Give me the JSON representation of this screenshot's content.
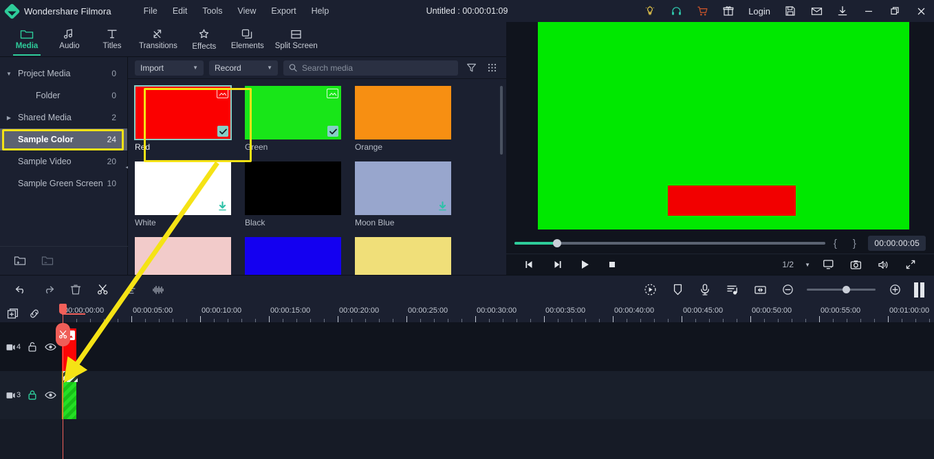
{
  "app": {
    "name": "Wondershare Filmora",
    "project_title": "Untitled : 00:00:01:09"
  },
  "menubar": [
    {
      "label": "File"
    },
    {
      "label": "Edit"
    },
    {
      "label": "Tools"
    },
    {
      "label": "View"
    },
    {
      "label": "Export"
    },
    {
      "label": "Help"
    }
  ],
  "titlebar_icons": [
    {
      "name": "lightbulb-icon",
      "color": "#e8c84a"
    },
    {
      "name": "headset-icon",
      "color": "#2ec2a8"
    },
    {
      "name": "cart-icon",
      "color": "#c4522a"
    },
    {
      "name": "gift-icon",
      "color": "#e3e6eb"
    },
    {
      "name": "save-icon",
      "color": "#e3e6eb"
    },
    {
      "name": "mail-icon",
      "color": "#e3e6eb"
    },
    {
      "name": "download-icon",
      "color": "#e3e6eb"
    }
  ],
  "login_label": "Login",
  "tooltabs": [
    {
      "label": "Media",
      "icon": "folder-icon",
      "active": true
    },
    {
      "label": "Audio",
      "icon": "music-note-icon",
      "active": false
    },
    {
      "label": "Titles",
      "icon": "text-t-icon",
      "active": false
    },
    {
      "label": "Transitions",
      "icon": "transition-arrows-icon",
      "active": false
    },
    {
      "label": "Effects",
      "icon": "sparkle-icon",
      "active": false
    },
    {
      "label": "Elements",
      "icon": "layers-icon",
      "active": false
    },
    {
      "label": "Split Screen",
      "icon": "split-screen-icon",
      "active": false
    }
  ],
  "export_label": "EXPORT",
  "sidebar": {
    "items": [
      {
        "label": "Project Media",
        "count": "0",
        "caret": "down",
        "indent": false,
        "selected": false
      },
      {
        "label": "Folder",
        "count": "0",
        "caret": "none",
        "indent": true,
        "selected": false
      },
      {
        "label": "Shared Media",
        "count": "2",
        "caret": "right",
        "indent": false,
        "selected": false
      },
      {
        "label": "Sample Color",
        "count": "24",
        "caret": "none",
        "indent": false,
        "selected": true
      },
      {
        "label": "Sample Video",
        "count": "20",
        "caret": "none",
        "indent": false,
        "selected": false
      },
      {
        "label": "Sample Green Screen",
        "count": "10",
        "caret": "none",
        "indent": false,
        "selected": false
      }
    ],
    "footer_icons": [
      {
        "name": "new-folder-icon"
      },
      {
        "name": "remove-folder-icon"
      }
    ]
  },
  "media_toolbar": {
    "import": {
      "label": "Import"
    },
    "record": {
      "label": "Record"
    },
    "search": {
      "placeholder": "Search media",
      "value": ""
    },
    "filter_icon": "filter-icon",
    "grid_icon": "grid-view-icon"
  },
  "media_items": [
    {
      "label": "Red",
      "color": "#fb0000",
      "selected": true,
      "badge_img": true,
      "badge_check": true,
      "badge_dl": false
    },
    {
      "label": "Green",
      "color": "#18e618",
      "selected": false,
      "badge_img": true,
      "badge_check": true,
      "badge_dl": false
    },
    {
      "label": "Orange",
      "color": "#f78f12",
      "selected": false,
      "badge_img": false,
      "badge_check": false,
      "badge_dl": false
    },
    {
      "label": "White",
      "color": "#ffffff",
      "selected": false,
      "badge_img": false,
      "badge_check": false,
      "badge_dl": true
    },
    {
      "label": "Black",
      "color": "#000000",
      "selected": false,
      "badge_img": false,
      "badge_check": false,
      "badge_dl": false
    },
    {
      "label": "Moon Blue",
      "color": "#98a6cd",
      "selected": false,
      "badge_img": false,
      "badge_check": false,
      "badge_dl": true
    },
    {
      "label": "",
      "color": "#f2cbca",
      "selected": false,
      "badge_img": false,
      "badge_check": false,
      "badge_dl": false
    },
    {
      "label": "",
      "color": "#1400f0",
      "selected": false,
      "badge_img": false,
      "badge_check": false,
      "badge_dl": false
    },
    {
      "label": "",
      "color": "#f0df79",
      "selected": false,
      "badge_img": false,
      "badge_check": false,
      "badge_dl": false
    }
  ],
  "preview": {
    "background_color": "#00e800",
    "rect_color": "#f20000",
    "timecode": "00:00:00:05",
    "mark_in": "{",
    "mark_out": "}",
    "ratio": "1/2",
    "transport": [
      {
        "name": "prev-frame-button"
      },
      {
        "name": "next-frame-button"
      },
      {
        "name": "play-button"
      },
      {
        "name": "stop-button"
      }
    ],
    "right_icons": [
      {
        "name": "display-settings-icon"
      },
      {
        "name": "snapshot-camera-icon"
      },
      {
        "name": "volume-icon"
      },
      {
        "name": "fullscreen-icon"
      }
    ]
  },
  "timeline_toolbar": {
    "left_icons": [
      {
        "name": "undo-icon"
      },
      {
        "name": "redo-icon"
      },
      {
        "name": "delete-icon"
      },
      {
        "name": "split-scissors-icon"
      },
      {
        "name": "crop-icon"
      },
      {
        "name": "audio-waveform-icon"
      }
    ],
    "right_icons": [
      {
        "name": "color-match-icon"
      },
      {
        "name": "marker-icon"
      },
      {
        "name": "voiceover-mic-icon"
      },
      {
        "name": "audio-mixer-icon"
      },
      {
        "name": "zoom-to-fit-icon"
      }
    ],
    "zoom_out_icon": "zoom-out-icon",
    "zoom_in_icon": "zoom-in-icon",
    "render_icon": "render-preview-icon"
  },
  "timeline": {
    "header_icons": [
      {
        "name": "add-track-icon"
      },
      {
        "name": "link-toggle-icon"
      }
    ],
    "ruler_labels": [
      "00:00:00:00",
      "00:00:05:00",
      "00:00:10:00",
      "00:00:15:00",
      "00:00:20:00",
      "00:00:25:00",
      "00:00:30:00",
      "00:00:35:00",
      "00:00:40:00",
      "00:00:45:00",
      "00:00:50:00",
      "00:00:55:00",
      "00:01:00:00"
    ],
    "tracks": [
      {
        "number": "4",
        "type": "video",
        "locked": false,
        "visible": true,
        "clip": {
          "kind": "red-color-clip",
          "color": "#fb0606",
          "badge": "image-icon"
        }
      },
      {
        "number": "3",
        "type": "video",
        "locked": true,
        "visible": true,
        "clip": {
          "kind": "green-screen-clip",
          "color": "#24e024",
          "badge": "none"
        }
      }
    ]
  },
  "annotations": {
    "highlight_color": "#f5e315",
    "arrow_color": "#f5e315",
    "highlights": [
      {
        "name": "sample-color-highlight"
      },
      {
        "name": "red-thumbnail-highlight"
      }
    ],
    "arrow": {
      "name": "drag-media-to-timeline-arrow"
    }
  }
}
